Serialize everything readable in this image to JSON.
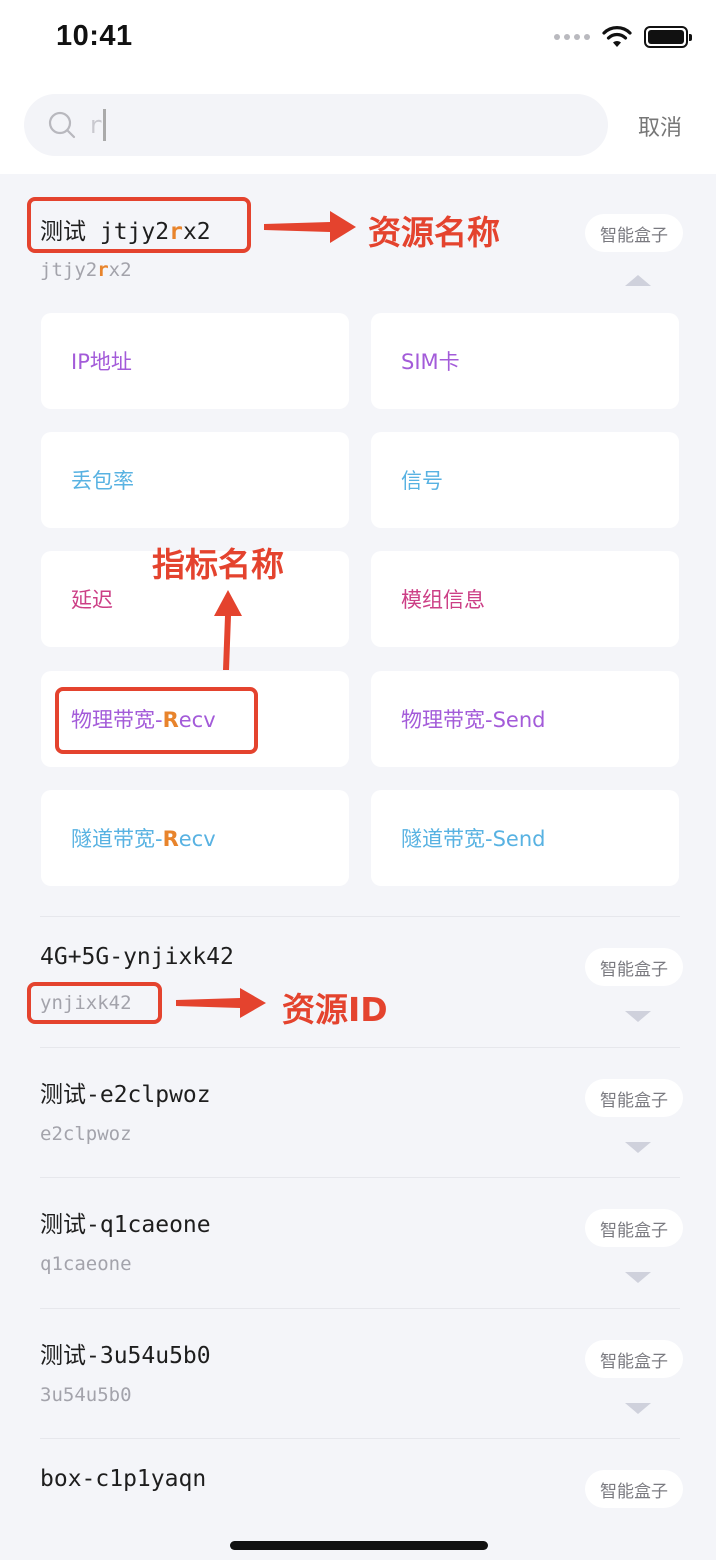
{
  "status_bar": {
    "time": "10:41",
    "icons": [
      "signal-dots-icon",
      "wifi-icon",
      "battery-icon"
    ]
  },
  "search": {
    "value": "r",
    "cancel_label": "取消"
  },
  "resources": [
    {
      "name_prefix": "测试 jtjy2",
      "name_highlight": "r",
      "name_suffix": "x2",
      "id_prefix": "jtjy2",
      "id_highlight": "r",
      "id_suffix": "x2",
      "tag": "智能盒子",
      "expanded": true,
      "metrics": [
        {
          "label": "IP地址",
          "color": "#a35bd9"
        },
        {
          "label": "SIM卡",
          "color": "#a35bd9"
        },
        {
          "label": "丢包率",
          "color": "#58b2e2"
        },
        {
          "label": "信号",
          "color": "#58b2e2"
        },
        {
          "label": "延迟",
          "color": "#cc3f86"
        },
        {
          "label": "模组信息",
          "color": "#cc3f86"
        },
        {
          "label_prefix": "物理带宽-",
          "label_highlight": "R",
          "label_suffix": "ecv",
          "color": "#a35bd9"
        },
        {
          "label": "物理带宽-Send",
          "color": "#a35bd9"
        },
        {
          "label_prefix": "隧道带宽-",
          "label_highlight": "R",
          "label_suffix": "ecv",
          "color": "#58b2e2"
        },
        {
          "label": "隧道带宽-Send",
          "color": "#58b2e2"
        }
      ]
    },
    {
      "name": "4G+5G-ynjixk42",
      "id": "ynjixk42",
      "tag": "智能盒子",
      "expanded": false
    },
    {
      "name": "测试-e2clpwoz",
      "id": "e2clpwoz",
      "tag": "智能盒子",
      "expanded": false
    },
    {
      "name": "测试-q1caeone",
      "id": "q1caeone",
      "tag": "智能盒子",
      "expanded": false
    },
    {
      "name": "测试-3u54u5b0",
      "id": "3u54u5b0",
      "tag": "智能盒子",
      "expanded": false
    },
    {
      "name": "box-c1p1yaqn",
      "id": "",
      "tag": "智能盒子",
      "expanded": false
    }
  ],
  "annotations": {
    "resource_name": "资源名称",
    "metric_name": "指标名称",
    "resource_id": "资源ID"
  },
  "colors": {
    "annotation": "#e4432e",
    "highlight": "#e8842c",
    "purple": "#a35bd9",
    "blue": "#58b2e2",
    "pink": "#cc3f86"
  }
}
